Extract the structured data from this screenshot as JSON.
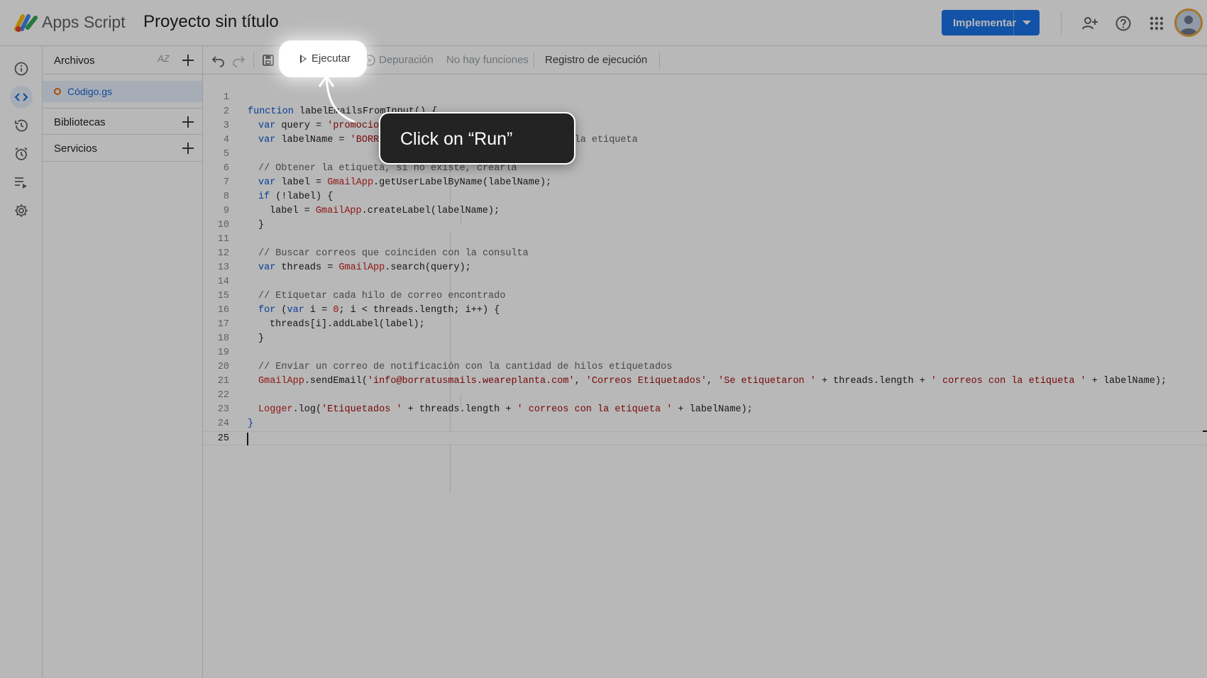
{
  "header": {
    "app_name": "Apps Script",
    "project_title": "Proyecto sin título",
    "deploy_label": "Implementar"
  },
  "files_panel": {
    "title": "Archivos",
    "sort_label": "AZ",
    "files": [
      {
        "name": "Código.gs"
      }
    ],
    "sections": [
      {
        "label": "Bibliotecas"
      },
      {
        "label": "Servicios"
      }
    ]
  },
  "toolbar": {
    "run_label": "Ejecutar",
    "debug_label": "Depuración",
    "function_select": "No hay funciones",
    "execution_log_label": "Registro de ejecución"
  },
  "editor": {
    "line_numbers": [
      "1",
      "2",
      "3",
      "4",
      "5",
      "6",
      "7",
      "8",
      "9",
      "10",
      "11",
      "12",
      "13",
      "14",
      "15",
      "16",
      "17",
      "18",
      "19",
      "20",
      "21",
      "22",
      "23",
      "24",
      "25"
    ]
  },
  "tutorial": {
    "tooltip": "Click on “Run”"
  },
  "colors": {
    "accent": "#1a73e8",
    "file_icon": "#e37400",
    "tooltip_bg": "#232323"
  }
}
